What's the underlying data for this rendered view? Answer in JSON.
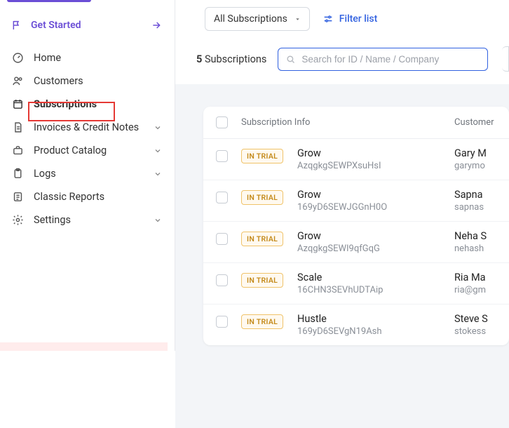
{
  "sidebar": {
    "get_started": "Get Started",
    "items": [
      {
        "label": "Home"
      },
      {
        "label": "Customers"
      },
      {
        "label": "Subscriptions"
      },
      {
        "label": "Invoices & Credit Notes"
      },
      {
        "label": "Product Catalog"
      },
      {
        "label": "Logs"
      },
      {
        "label": "Classic Reports"
      },
      {
        "label": "Settings"
      }
    ]
  },
  "toolbar": {
    "dropdown_label": "All Subscriptions",
    "filter_label": "Filter list"
  },
  "results": {
    "count": "5",
    "count_label": "Subscriptions",
    "search_placeholder": "Search for ID / Name / Company"
  },
  "table": {
    "header_info": "Subscription Info",
    "header_customer": "Customer",
    "rows": [
      {
        "status": "IN TRIAL",
        "plan": "Grow",
        "id": "AzqgkgSEWPXsuHsI",
        "cust_name": "Gary M",
        "cust_sub": "garymo"
      },
      {
        "status": "IN TRIAL",
        "plan": "Grow",
        "id": "169yD6SEWJGGnH0O",
        "cust_name": "Sapna",
        "cust_sub": "sapnas"
      },
      {
        "status": "IN TRIAL",
        "plan": "Grow",
        "id": "AzqgkgSEWI9qfGqG",
        "cust_name": "Neha S",
        "cust_sub": "nehash"
      },
      {
        "status": "IN TRIAL",
        "plan": "Scale",
        "id": "16CHN3SEVhUDTAip",
        "cust_name": "Ria Ma",
        "cust_sub": "ria@gm"
      },
      {
        "status": "IN TRIAL",
        "plan": "Hustle",
        "id": "169yD6SEVgN19Ash",
        "cust_name": "Steve S",
        "cust_sub": "stokess"
      }
    ]
  }
}
